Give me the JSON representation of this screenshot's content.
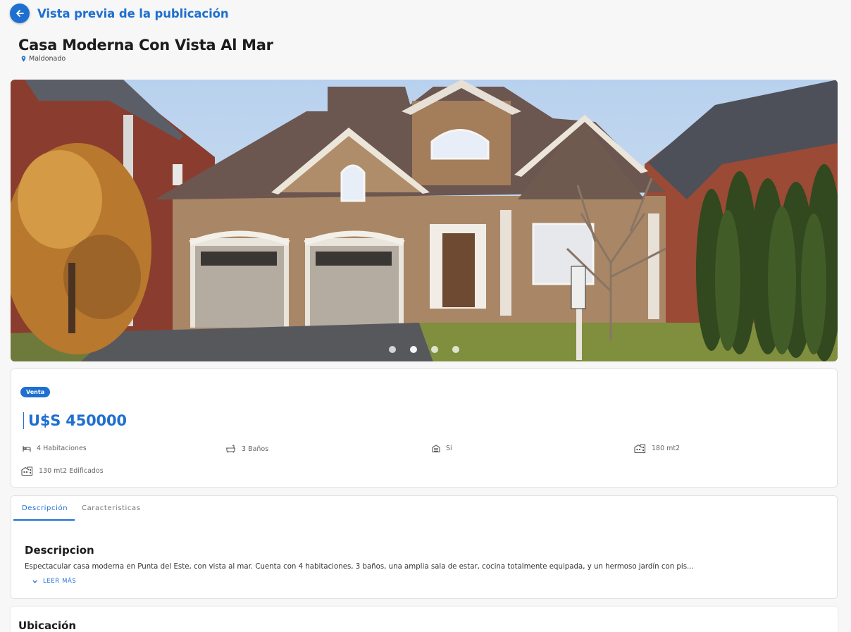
{
  "header": {
    "title": "Vista previa de la publicación",
    "back_icon": "arrow-left-icon"
  },
  "property": {
    "title": "Casa Moderna Con Vista Al Mar",
    "location": "Maldonado",
    "operation_badge": "Venta",
    "price": "U$S 450000"
  },
  "gallery": {
    "slide_count": 4,
    "active_slide": 1
  },
  "features": [
    {
      "icon": "bed-icon",
      "label": "4 Habitaciones"
    },
    {
      "icon": "bathtub-icon",
      "label": "3 Baños"
    },
    {
      "icon": "garage-icon",
      "label": "Sí"
    },
    {
      "icon": "building-icon",
      "label": "180 mt2"
    },
    {
      "icon": "building-icon",
      "label": "130 mt2 Edificados"
    }
  ],
  "tabs": [
    {
      "label": "Descripción",
      "active": true
    },
    {
      "label": "Caracteristicas",
      "active": false
    }
  ],
  "description": {
    "heading": "Descripcion",
    "text": "Espectacular casa moderna en Punta del Este, con vista al mar. Cuenta con 4 habitaciones, 3 baños, una amplia sala de estar, cocina totalmente equipada, y un hermoso jardín con pis...",
    "read_more": "LEER MÁS"
  },
  "location_section": {
    "title": "Ubicación"
  },
  "colors": {
    "accent": "#1e6fd0",
    "background": "#f7f7f7"
  }
}
